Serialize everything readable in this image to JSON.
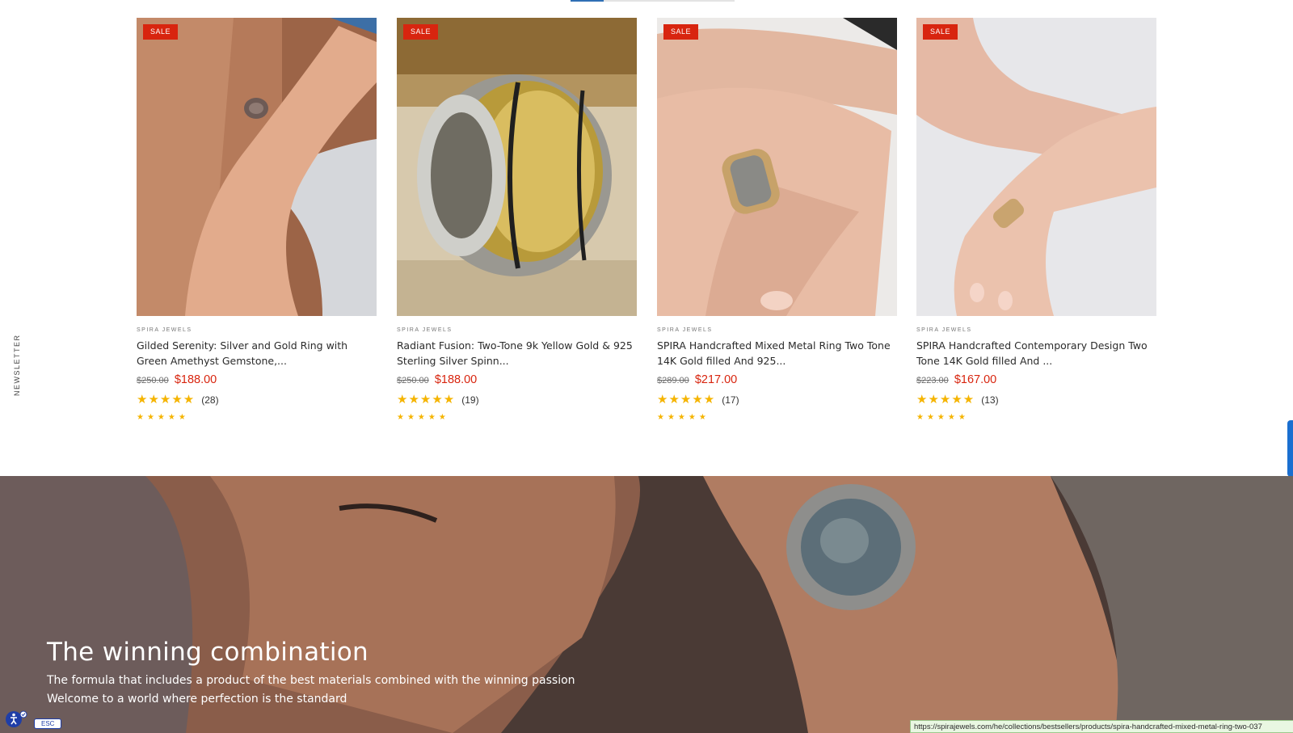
{
  "carousel": {
    "progress": 0.2
  },
  "newsletter_tab": {
    "label": "NEWSLETTER"
  },
  "products": [
    {
      "badge": "SALE",
      "vendor": "SPIRA JEWELS",
      "title": "Gilded Serenity: Silver and Gold Ring with Green Amethyst Gemstone,...",
      "price_old": "$250.00",
      "price_new": "$188.00",
      "rating": 5,
      "review_count": "(28)",
      "mini_stars": "★★★★★"
    },
    {
      "badge": "SALE",
      "vendor": "SPIRA JEWELS",
      "title": "Radiant Fusion: Two-Tone 9k Yellow Gold & 925 Sterling Silver Spinn...",
      "price_old": "$250.00",
      "price_new": "$188.00",
      "rating": 5,
      "review_count": "(19)",
      "mini_stars": "★★★★★"
    },
    {
      "badge": "SALE",
      "vendor": "SPIRA JEWELS",
      "title": "SPIRA Handcrafted Mixed Metal Ring Two Tone 14K Gold filled And 925...",
      "price_old": "$289.00",
      "price_new": "$217.00",
      "rating": 5,
      "review_count": "(17)",
      "mini_stars": "★★★★★"
    },
    {
      "badge": "SALE",
      "vendor": "SPIRA JEWELS",
      "title": "SPIRA Handcrafted Contemporary Design Two Tone 14K Gold filled And ...",
      "price_old": "$223.00",
      "price_new": "$167.00",
      "rating": 5,
      "review_count": "(13)",
      "mini_stars": "★★★★★"
    }
  ],
  "stars": "★★★★★",
  "hero": {
    "heading": "The winning combination",
    "line1": "The formula that includes a product of the best materials combined with the winning passion",
    "line2": "Welcome to a world where perfection is the standard"
  },
  "accessibility": {
    "icon": "accessibility-icon",
    "esc_label": "ESC"
  },
  "status_bar": {
    "url": "https://spirajewels.com/he/collections/bestsellers/products/spira-handcrafted-mixed-metal-ring-two-037"
  },
  "colors": {
    "sale": "#d8250f",
    "star": "#f5b400",
    "accent": "#1a6fd0"
  }
}
